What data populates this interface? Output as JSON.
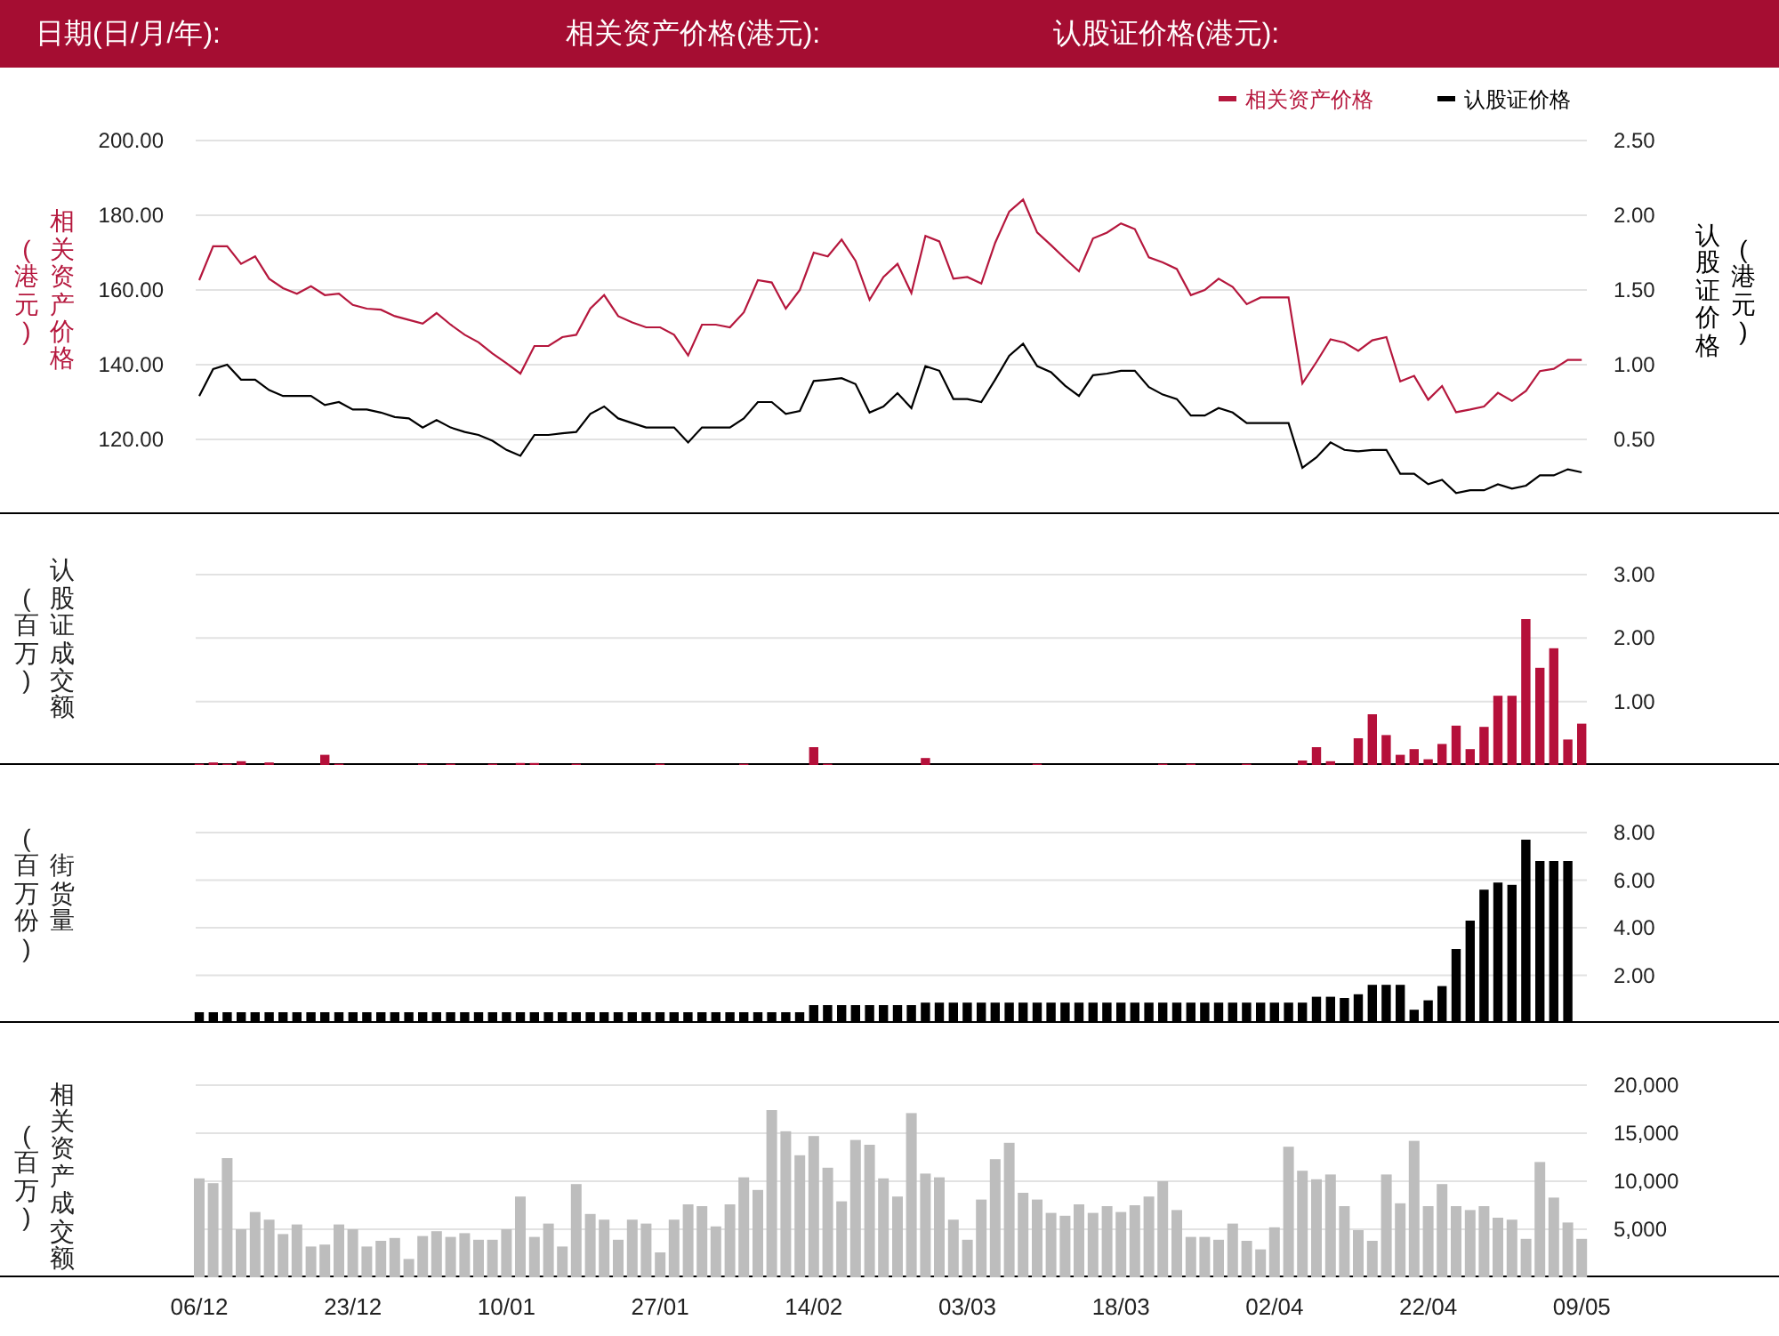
{
  "header": {
    "fields": [
      {
        "label": "日期(日/月/年):"
      },
      {
        "label": "相关资产价格(港元):"
      },
      {
        "label": "认股证价格(港元):"
      }
    ]
  },
  "panels": [
    {
      "kind": "line",
      "ylabel_unit": "(港元)",
      "y2label_unit": "(港元)",
      "chart_data": {
        "type": "line",
        "grid": true,
        "legend": "top-right",
        "ylabel": "相关资产价格",
        "y2label": "认股证价格",
        "ylim": [
          100,
          200
        ],
        "yticks": [
          {
            "value": 120,
            "label": "120.00"
          },
          {
            "value": 140,
            "label": "140.00"
          },
          {
            "value": 160,
            "label": "160.00"
          },
          {
            "value": 180,
            "label": "180.00"
          },
          {
            "value": 200,
            "label": "200.00"
          }
        ],
        "y2lim": [
          0,
          2.5
        ],
        "y2ticks": [
          {
            "value": 0.5,
            "label": "0.50"
          },
          {
            "value": 1,
            "label": "1.00"
          },
          {
            "value": 1.5,
            "label": "1.50"
          },
          {
            "value": 2,
            "label": "2.00"
          },
          {
            "value": 2.5,
            "label": "2.50"
          }
        ],
        "series": [
          {
            "name": "相关资产价格",
            "color": "#b5173d",
            "values": [
              162.6,
              171.7,
              171.7,
              167,
              169,
              163,
              160.5,
              159,
              161,
              158.6,
              159,
              156,
              155,
              154.7,
              153,
              152,
              151,
              153.8,
              150.7,
              148,
              146,
              143,
              140.4,
              137.6,
              145,
              145,
              147.4,
              148,
              155,
              158.6,
              153,
              151.3,
              150,
              150,
              148,
              142.5,
              150.7,
              150.7,
              150,
              154,
              162.6,
              162,
              155,
              160,
              170,
              169,
              173.5,
              167.8,
              157.4,
              163.5,
              167,
              159.2,
              174.5,
              173,
              163,
              163.5,
              161.7,
              172.6,
              181,
              184.2,
              175.4,
              172,
              168.4,
              165,
              173.8,
              175.4,
              177.8,
              176.3,
              168.7,
              167.4,
              165.6,
              158.6,
              160,
              163,
              160.8,
              156.2,
              158,
              158,
              158,
              135,
              140.7,
              146.8,
              145.9,
              143.7,
              146.5,
              147.4,
              135.5,
              137,
              130.6,
              134.3,
              127.3,
              128,
              128.8,
              132.5,
              130.3,
              133,
              138.3,
              138.9,
              141.3,
              141.3
            ]
          },
          {
            "name": "认股证价格",
            "color": "#000000",
            "axis": "y2",
            "values": [
              0.79,
              0.97,
              1.0,
              0.9,
              0.9,
              0.83,
              0.79,
              0.79,
              0.79,
              0.73,
              0.75,
              0.7,
              0.7,
              0.68,
              0.65,
              0.64,
              0.58,
              0.63,
              0.58,
              0.55,
              0.53,
              0.49,
              0.43,
              0.39,
              0.53,
              0.53,
              0.54,
              0.55,
              0.67,
              0.72,
              0.64,
              0.61,
              0.58,
              0.58,
              0.58,
              0.48,
              0.58,
              0.58,
              0.58,
              0.64,
              0.75,
              0.75,
              0.67,
              0.69,
              0.89,
              0.9,
              0.91,
              0.87,
              0.68,
              0.72,
              0.81,
              0.71,
              0.99,
              0.96,
              0.77,
              0.77,
              0.75,
              0.9,
              1.06,
              1.14,
              0.99,
              0.95,
              0.86,
              0.79,
              0.93,
              0.94,
              0.96,
              0.96,
              0.85,
              0.8,
              0.77,
              0.66,
              0.66,
              0.71,
              0.68,
              0.61,
              0.61,
              0.61,
              0.61,
              0.31,
              0.38,
              0.48,
              0.43,
              0.42,
              0.43,
              0.43,
              0.27,
              0.27,
              0.2,
              0.23,
              0.14,
              0.16,
              0.16,
              0.2,
              0.17,
              0.19,
              0.26,
              0.26,
              0.3,
              0.28
            ]
          }
        ]
      }
    },
    {
      "kind": "bar",
      "ylabel_unit": "(百万)",
      "chart_data": {
        "type": "bar",
        "grid": true,
        "ylabel": "认股证成交额",
        "ylim": [
          0,
          3
        ],
        "yticks": [
          {
            "value": 1,
            "label": "1.00"
          },
          {
            "value": 2,
            "label": "2.00"
          },
          {
            "value": 3,
            "label": "3.00"
          }
        ],
        "series": [
          {
            "color": "#b5103a",
            "values": [
              0.02,
              0.04,
              0.02,
              0.06,
              0,
              0.04,
              0,
              0,
              0,
              0.16,
              0.02,
              0,
              0,
              0,
              0,
              0,
              0.02,
              0,
              0.02,
              0,
              0,
              0.02,
              0,
              0.03,
              0.03,
              0,
              0,
              0.02,
              0,
              0,
              0,
              0,
              0,
              0.02,
              0,
              0,
              0,
              0,
              0,
              0.02,
              0,
              0,
              0,
              0,
              0.28,
              0.02,
              0,
              0,
              0,
              0,
              0,
              0,
              0.11,
              0,
              0,
              0,
              0,
              0,
              0,
              0,
              0.02,
              0,
              0,
              0,
              0,
              0,
              0,
              0,
              0,
              0.02,
              0,
              0.02,
              0,
              0,
              0,
              0.02,
              0,
              0,
              0,
              0.07,
              0.28,
              0.06,
              0,
              0.42,
              0.8,
              0.47,
              0.16,
              0.25,
              0.09,
              0.33,
              0.62,
              0.25,
              0.6,
              1.09,
              1.09,
              2.3,
              1.53,
              1.84,
              0.4,
              0.65
            ]
          }
        ]
      }
    },
    {
      "kind": "bar",
      "ylabel_unit": "(百万份)",
      "chart_data": {
        "type": "bar",
        "grid": true,
        "ylabel": "街货量",
        "ylim": [
          0,
          8
        ],
        "yticks": [
          {
            "value": 2,
            "label": "2.00"
          },
          {
            "value": 4,
            "label": "4.00"
          },
          {
            "value": 6,
            "label": "6.00"
          },
          {
            "value": 8,
            "label": "8.00"
          }
        ],
        "series": [
          {
            "color": "#000000",
            "values": [
              0.45,
              0.45,
              0.45,
              0.45,
              0.45,
              0.45,
              0.45,
              0.45,
              0.45,
              0.45,
              0.45,
              0.45,
              0.45,
              0.45,
              0.45,
              0.45,
              0.45,
              0.45,
              0.45,
              0.45,
              0.45,
              0.45,
              0.45,
              0.45,
              0.45,
              0.45,
              0.45,
              0.45,
              0.45,
              0.45,
              0.45,
              0.45,
              0.45,
              0.45,
              0.45,
              0.45,
              0.45,
              0.45,
              0.45,
              0.45,
              0.45,
              0.45,
              0.45,
              0.45,
              0.75,
              0.75,
              0.75,
              0.75,
              0.75,
              0.75,
              0.75,
              0.75,
              0.85,
              0.85,
              0.85,
              0.85,
              0.85,
              0.85,
              0.85,
              0.85,
              0.85,
              0.85,
              0.85,
              0.85,
              0.85,
              0.85,
              0.85,
              0.85,
              0.85,
              0.85,
              0.85,
              0.85,
              0.85,
              0.85,
              0.85,
              0.85,
              0.85,
              0.85,
              0.85,
              0.85,
              1.1,
              1.1,
              1.05,
              1.2,
              1.6,
              1.6,
              1.6,
              0.55,
              0.95,
              1.55,
              3.1,
              4.3,
              5.6,
              5.9,
              5.8,
              7.7,
              6.8,
              6.8,
              6.8,
              null
            ]
          }
        ]
      }
    },
    {
      "kind": "bar",
      "ylabel_unit": "(百万)",
      "chart_data": {
        "type": "bar",
        "grid": true,
        "ylabel": "相关资产成交额",
        "categories": [
          "06/12",
          null,
          null,
          null,
          null,
          null,
          null,
          null,
          null,
          null,
          null,
          "23/12",
          null,
          null,
          null,
          null,
          null,
          null,
          null,
          null,
          null,
          null,
          "10/01",
          null,
          null,
          null,
          null,
          null,
          null,
          null,
          null,
          null,
          null,
          "27/01",
          null,
          null,
          null,
          null,
          null,
          null,
          null,
          null,
          null,
          null,
          "14/02",
          null,
          null,
          null,
          null,
          null,
          null,
          null,
          null,
          null,
          null,
          "03/03",
          null,
          null,
          null,
          null,
          null,
          null,
          null,
          null,
          null,
          null,
          "18/03",
          null,
          null,
          null,
          null,
          null,
          null,
          null,
          null,
          null,
          null,
          "02/04",
          null,
          null,
          null,
          null,
          null,
          null,
          null,
          null,
          null,
          null,
          "22/04",
          null,
          null,
          null,
          null,
          null,
          null,
          null,
          null,
          null,
          null,
          "09/05"
        ],
        "ylim": [
          0,
          20000
        ],
        "yticks": [
          {
            "value": 5000,
            "label": "5,000"
          },
          {
            "value": 10000,
            "label": "10,000"
          },
          {
            "value": 15000,
            "label": "15,000"
          },
          {
            "value": 20000,
            "label": "20,000"
          }
        ],
        "series": [
          {
            "color": "#bdbdbd",
            "values": [
              10300,
              9800,
              12400,
              5000,
              6800,
              6000,
              4500,
              5500,
              3200,
              3400,
              5500,
              5000,
              3200,
              3800,
              4100,
              1900,
              4300,
              4800,
              4200,
              4600,
              3900,
              3900,
              5000,
              8400,
              4200,
              5600,
              3200,
              9700,
              6600,
              6000,
              3900,
              6000,
              5600,
              2600,
              6000,
              7600,
              7400,
              5300,
              7600,
              10400,
              9100,
              17400,
              15200,
              12700,
              14700,
              11400,
              7900,
              14300,
              13800,
              10300,
              8400,
              17100,
              10800,
              10400,
              6000,
              3900,
              8100,
              12300,
              14000,
              8800,
              8100,
              6700,
              6400,
              7600,
              6700,
              7400,
              6800,
              7500,
              8400,
              10000,
              7000,
              4200,
              4200,
              3900,
              5600,
              3800,
              2900,
              5200,
              13600,
              11100,
              10200,
              10700,
              7400,
              4900,
              3800,
              10700,
              7700,
              14200,
              7400,
              9700,
              7400,
              7000,
              7400,
              6200,
              6000,
              4000,
              12000,
              8300,
              5700,
              4000
            ]
          }
        ]
      }
    }
  ]
}
